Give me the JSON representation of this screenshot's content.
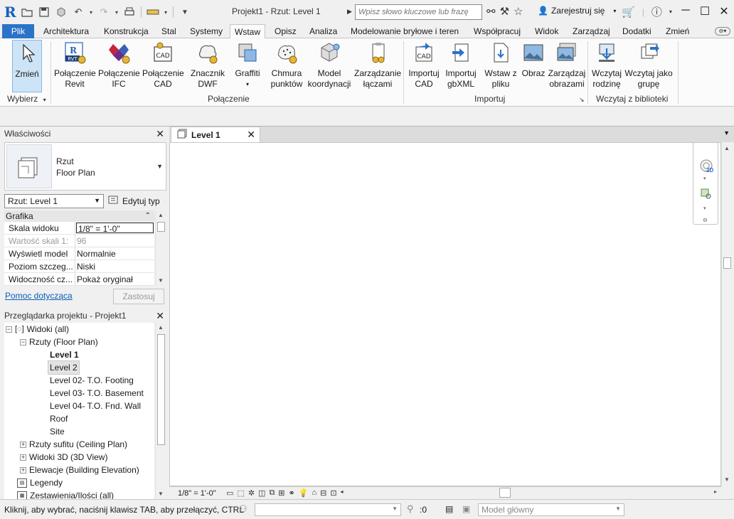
{
  "title_bar": {
    "window_title": "Projekt1 - Rzut: Level 1",
    "search_placeholder": "Wpisz słowo kluczowe lub frazę",
    "sign_in": "Zarejestruj się",
    "qat_icons": [
      "open-icon",
      "save-icon",
      "sync-icon",
      "undo-icon",
      "redo-icon",
      "print-icon",
      "measure-icon",
      "customize-icon"
    ]
  },
  "ribbon_tabs": [
    "Plik",
    "Architektura",
    "Konstrukcja",
    "Stal",
    "Systemy",
    "Wstaw",
    "Opisz",
    "Analiza",
    "Modelowanie bryłowe i teren",
    "Współpracuj",
    "Widok",
    "Zarządzaj",
    "Dodatki",
    "Zmień"
  ],
  "active_tab": "Wstaw",
  "ribbon": {
    "select": {
      "modify_label": "Zmień",
      "panel_label": "Wybierz"
    },
    "link_panel": {
      "label": "Połączenie",
      "buttons": [
        {
          "label": "Połączenie Revit",
          "icon": "link-revit-icon"
        },
        {
          "label": "Połączenie IFC",
          "icon": "link-ifc-icon"
        },
        {
          "label": "Połączenie CAD",
          "icon": "link-cad-icon"
        },
        {
          "label": "Znacznik DWF",
          "icon": "dwf-markup-icon"
        },
        {
          "label": "Graffiti",
          "icon": "decal-icon"
        },
        {
          "label": "Chmura punktów",
          "icon": "point-cloud-icon"
        },
        {
          "label": "Model koordynacji",
          "icon": "coordination-model-icon"
        },
        {
          "label": "Zarządzanie łączami",
          "icon": "manage-links-icon"
        }
      ]
    },
    "import_panel": {
      "label": "Importuj",
      "buttons": [
        {
          "label": "Importuj CAD",
          "icon": "import-cad-icon"
        },
        {
          "label": "Importuj gbXML",
          "icon": "import-gbxml-icon"
        },
        {
          "label": "Wstaw z pliku",
          "icon": "insert-from-file-icon"
        },
        {
          "label": "Obraz",
          "icon": "image-icon"
        },
        {
          "label": "Zarządzaj obrazami",
          "icon": "manage-images-icon"
        }
      ]
    },
    "library_panel": {
      "label": "Wczytaj z biblioteki",
      "buttons": [
        {
          "label": "Wczytaj rodzinę",
          "icon": "load-family-icon"
        },
        {
          "label": "Wczytaj jako grupę",
          "icon": "load-group-icon"
        }
      ]
    }
  },
  "properties": {
    "title": "Właściwości",
    "type_name_line1": "Rzut",
    "type_name_line2": "Floor Plan",
    "instance_selector": "Rzut: Level 1",
    "edit_type": "Edytuj typ",
    "group": "Grafika",
    "rows": [
      {
        "name": "Skala widoku",
        "value": "1/8\" = 1'-0\""
      },
      {
        "name": "Wartość skali   1:",
        "value": "96"
      },
      {
        "name": "Wyświetl model",
        "value": "Normalnie"
      },
      {
        "name": "Poziom szczeg...",
        "value": "Niski"
      },
      {
        "name": "Widoczność cz...",
        "value": "Pokaż oryginał"
      }
    ],
    "help_link": "Pomoc dotycząca",
    "apply": "Zastosuj"
  },
  "project_browser": {
    "title": "Przeglądarka projektu - Projekt1",
    "nodes": [
      {
        "label": "Widoki (all)"
      },
      {
        "label": "Rzuty (Floor Plan)"
      },
      {
        "label": "Level 1"
      },
      {
        "label": "Level 2"
      },
      {
        "label": "Level 02- T.O. Footing"
      },
      {
        "label": "Level 03- T.O. Basement"
      },
      {
        "label": "Level 04- T.O. Fnd. Wall"
      },
      {
        "label": "Roof"
      },
      {
        "label": "Site"
      },
      {
        "label": "Rzuty sufitu (Ceiling Plan)"
      },
      {
        "label": "Widoki 3D (3D View)"
      },
      {
        "label": "Elewacje (Building Elevation)"
      },
      {
        "label": "Legendy"
      },
      {
        "label": "Zestawienia/Ilości (all)"
      }
    ]
  },
  "view": {
    "tab_label": "Level 1",
    "scale": "1/8\" = 1'-0\"",
    "nav_2d": "2D"
  },
  "status_bar": {
    "hint": "Kliknij, aby wybrać, naciśnij klawisz TAB, aby przełączyć, CTRL",
    "filter_count": ":0",
    "model": "Model główny"
  }
}
